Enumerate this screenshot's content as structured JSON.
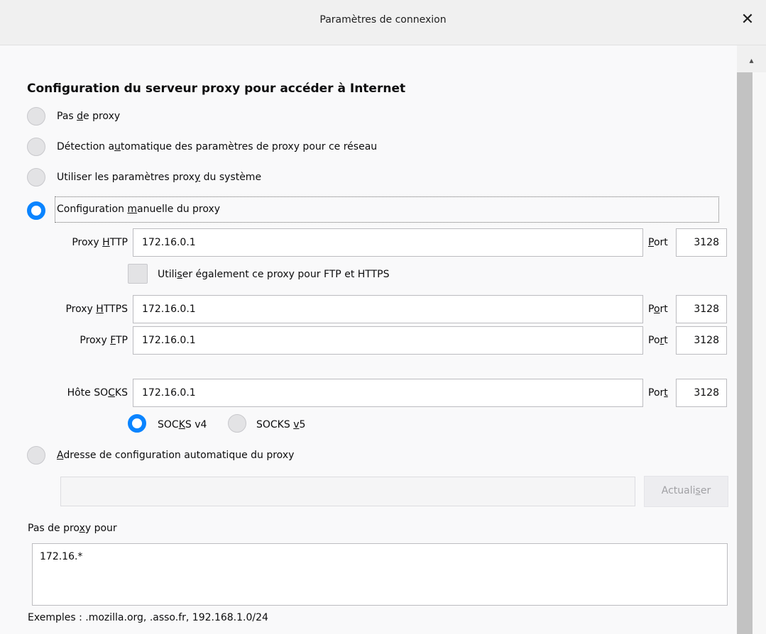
{
  "window": {
    "title": "Paramètres de connexion",
    "close_label": "✕"
  },
  "section": {
    "heading": "Configuration du serveur proxy pour accéder à Internet"
  },
  "options": {
    "no_proxy": {
      "before": "Pas ",
      "key": "d",
      "after": "e proxy"
    },
    "auto_detect": {
      "before": "Détection a",
      "key": "u",
      "after": "tomatique des paramètres de proxy pour ce réseau"
    },
    "system": {
      "before": "Utiliser les paramètres prox",
      "key": "y",
      "after": " du système"
    },
    "manual": {
      "before": "Configuration ",
      "key": "m",
      "after": "anuelle du proxy"
    },
    "auto_url": {
      "before": "",
      "key": "A",
      "after": "dresse de configuration automatique du proxy"
    }
  },
  "http": {
    "label_before": "Proxy ",
    "label_key": "H",
    "label_after": "TTP",
    "value": "172.16.0.1",
    "port_before": "",
    "port_key": "P",
    "port_after": "ort",
    "port": "3128"
  },
  "share": {
    "before": "Utili",
    "key": "s",
    "after": "er également ce proxy pour FTP et HTTPS"
  },
  "https": {
    "label_before": "Proxy ",
    "label_key": "H",
    "label_after": "TTPS",
    "value": "172.16.0.1",
    "port_before": "P",
    "port_key": "o",
    "port_after": "rt",
    "port": "3128"
  },
  "ftp": {
    "label_before": "Proxy ",
    "label_key": "F",
    "label_after": "TP",
    "value": "172.16.0.1",
    "port_before": "Po",
    "port_key": "r",
    "port_after": "t",
    "port": "3128"
  },
  "socks": {
    "label_before": "Hôte SO",
    "label_key": "C",
    "label_after": "KS",
    "value": "172.16.0.1",
    "port_before": "Por",
    "port_key": "t",
    "port_after": "",
    "port": "3128"
  },
  "socks_versions": {
    "v4": {
      "before": "SOC",
      "key": "K",
      "after": "S v4"
    },
    "v5": {
      "before": "SOCKS ",
      "key": "v",
      "after": "5"
    }
  },
  "autoconfig": {
    "value": "",
    "reload_before": "Actuali",
    "reload_key": "s",
    "reload_after": "er"
  },
  "no_proxy_for": {
    "label_before": "Pas de pro",
    "label_key": "x",
    "label_after": "y pour",
    "value": "172.16.*"
  },
  "examples": "Exemples : .mozilla.org, .asso.fr, 192.168.1.0/24",
  "scrollbar": {
    "up_icon": "▴"
  }
}
